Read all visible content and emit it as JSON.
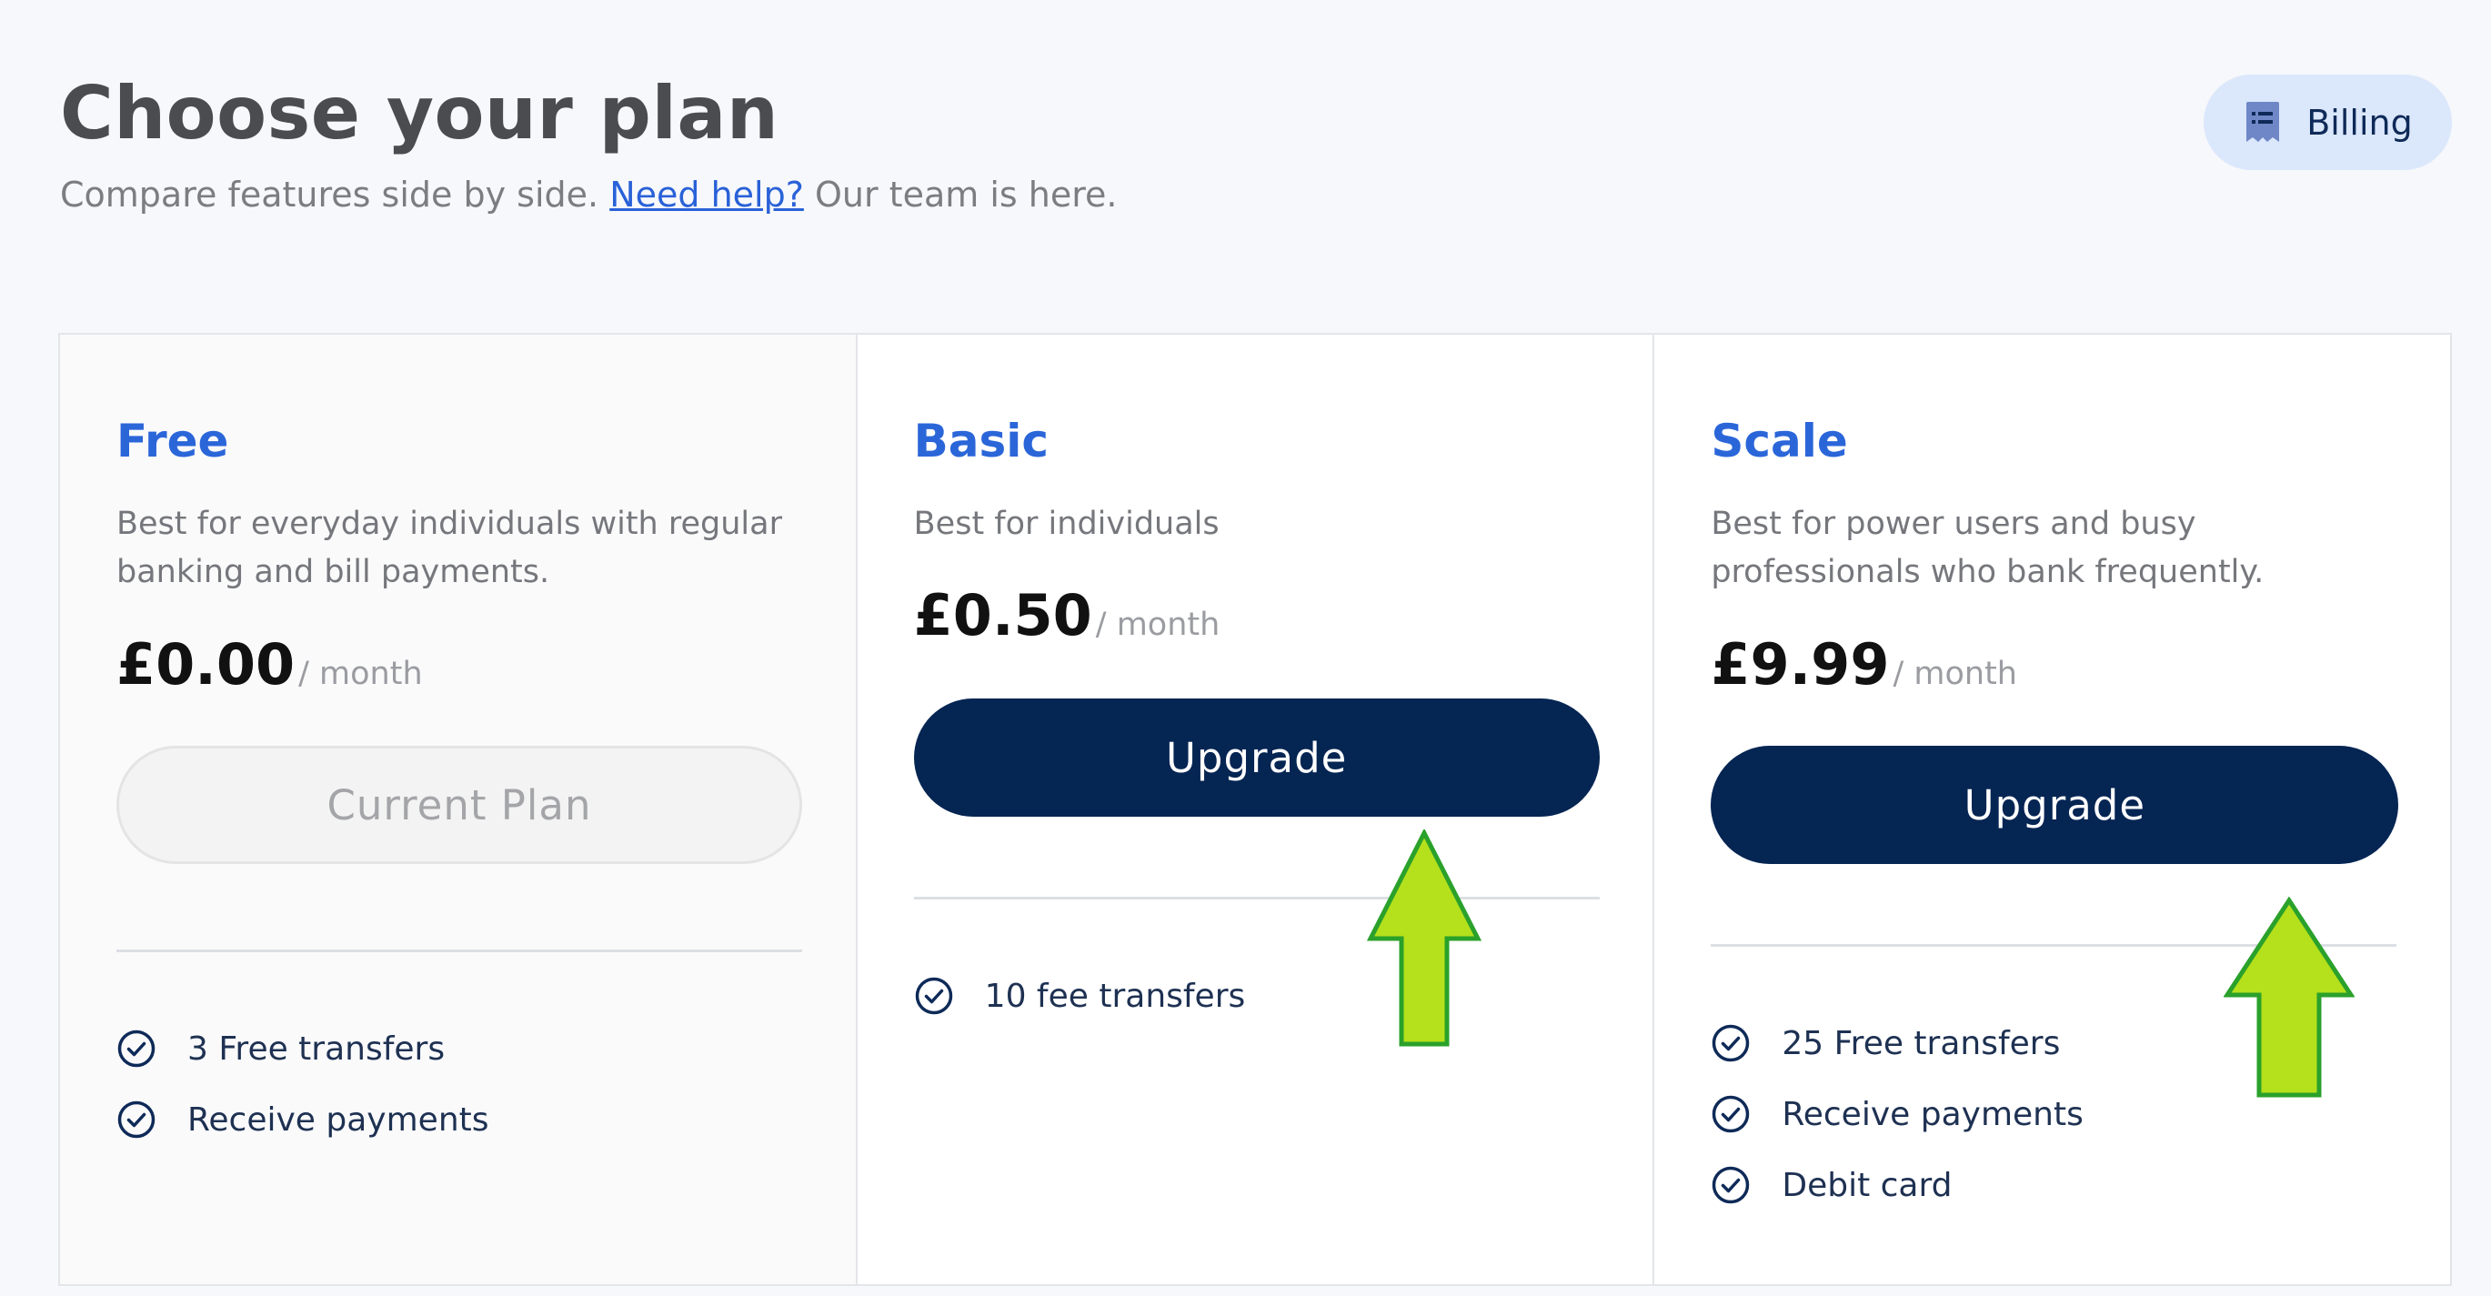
{
  "header": {
    "title": "Choose your plan",
    "subtitle_before": "Compare features side by side.",
    "help_link": "Need help?",
    "subtitle_after": "Our team is here.",
    "billing_label": "Billing"
  },
  "icons": {
    "billing": "receipt-list-icon",
    "feature": "check-circle-icon",
    "annotation": "up-arrow-icon"
  },
  "colors": {
    "accent": "#2b66d9",
    "button_dark": "#052553",
    "annotation_fill": "#b4e01c",
    "annotation_stroke": "#2aa12b"
  },
  "plans": [
    {
      "name": "Free",
      "description": "Best for everyday individuals with regular banking and bill payments.",
      "price": "£0.00",
      "period": "/ month",
      "button": "Current Plan",
      "features": [
        "3 Free transfers",
        "Receive payments"
      ]
    },
    {
      "name": "Basic",
      "description": "Best for individuals",
      "price": "£0.50",
      "period": "/ month",
      "button": "Upgrade",
      "features": [
        "10 fee transfers"
      ]
    },
    {
      "name": "Scale",
      "description": "Best for power users and busy professionals who bank frequently.",
      "price": "£9.99",
      "period": "/ month",
      "button": "Upgrade",
      "features": [
        "25 Free transfers",
        "Receive payments",
        "Debit card"
      ]
    }
  ]
}
